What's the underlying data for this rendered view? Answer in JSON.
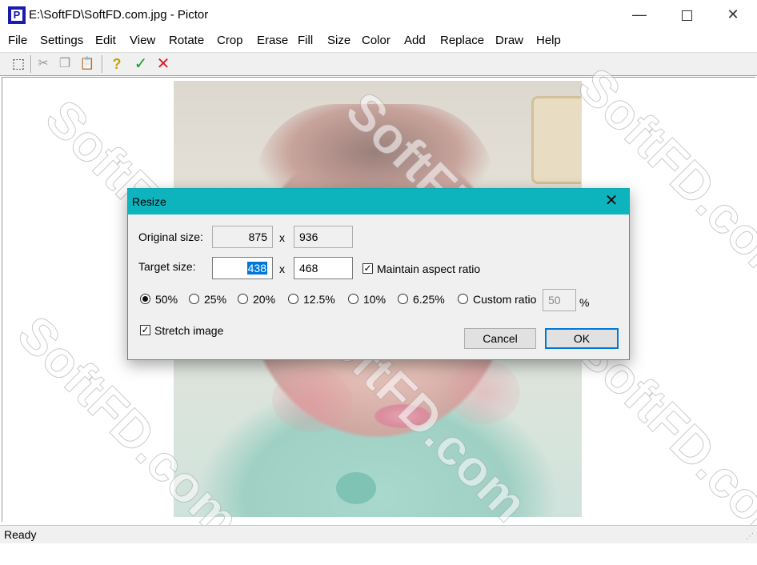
{
  "window": {
    "title": "E:\\SoftFD\\SoftFD.com.jpg - Pictor",
    "app_icon_letter": "P",
    "controls": {
      "minimize": "—",
      "close": "✕"
    }
  },
  "menu": [
    "File",
    "Settings",
    "Edit",
    "View",
    "Rotate",
    "Crop",
    "Erase",
    "Fill",
    "Size",
    "Color",
    "Add",
    "Replace",
    "Draw",
    "Help"
  ],
  "toolbar": {
    "select": "⬚",
    "cut": "✂",
    "copy": "❐",
    "paste": "📋",
    "help": "?",
    "apply": "✓",
    "cancel": "✕"
  },
  "statusbar": {
    "text": "Ready"
  },
  "dialog": {
    "title": "Resize",
    "close": "✕",
    "original_label": "Original size:",
    "original_width": "875",
    "original_height": "936",
    "target_label": "Target size:",
    "target_width": "438",
    "target_height": "468",
    "times": "x",
    "maintain_aspect": {
      "label": "Maintain aspect ratio",
      "checked": true
    },
    "ratios": [
      {
        "label": "50%",
        "selected": true
      },
      {
        "label": "25%",
        "selected": false
      },
      {
        "label": "20%",
        "selected": false
      },
      {
        "label": "12.5%",
        "selected": false
      },
      {
        "label": "10%",
        "selected": false
      },
      {
        "label": "6.25%",
        "selected": false
      },
      {
        "label": "Custom ratio",
        "selected": false
      }
    ],
    "custom_value": "50",
    "percent": "%",
    "stretch": {
      "label": "Stretch image",
      "checked": true
    },
    "cancel_label": "Cancel",
    "ok_label": "OK"
  },
  "watermark": "SoftFD.com"
}
